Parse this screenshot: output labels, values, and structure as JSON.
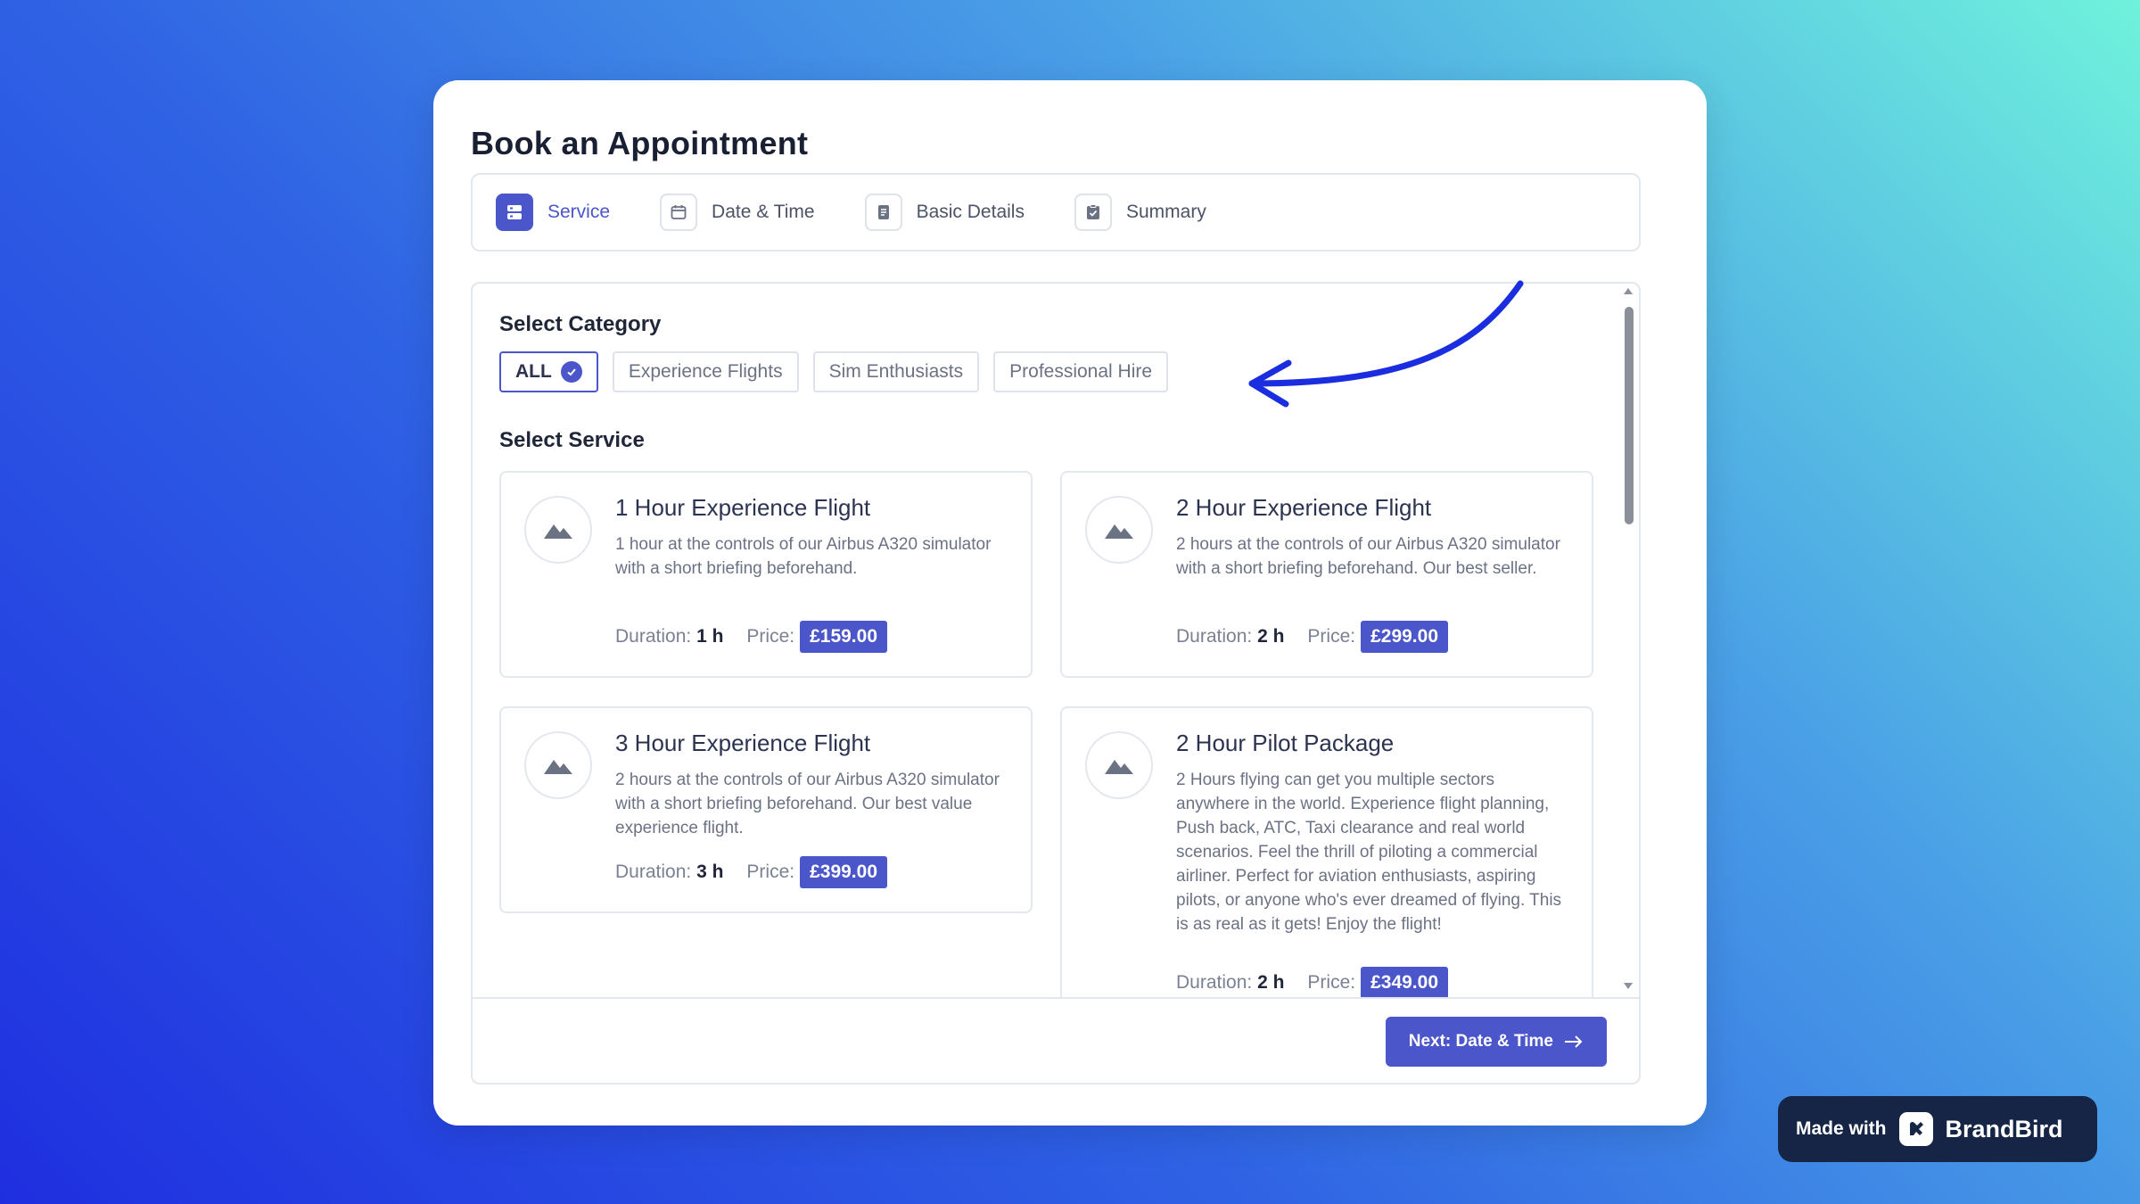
{
  "page": {
    "title": "Book an Appointment"
  },
  "steps": [
    {
      "label": "Service",
      "icon": "service-icon",
      "active": true
    },
    {
      "label": "Date & Time",
      "icon": "calendar-icon",
      "active": false
    },
    {
      "label": "Basic Details",
      "icon": "document-icon",
      "active": false
    },
    {
      "label": "Summary",
      "icon": "checklist-icon",
      "active": false
    }
  ],
  "category": {
    "title": "Select Category",
    "chips": [
      {
        "label": "ALL",
        "selected": true
      },
      {
        "label": "Experience Flights",
        "selected": false
      },
      {
        "label": "Sim Enthusiasts",
        "selected": false
      },
      {
        "label": "Professional Hire",
        "selected": false
      }
    ]
  },
  "service": {
    "title": "Select Service",
    "duration_label": "Duration:",
    "price_label": "Price:",
    "items": [
      {
        "name": "1 Hour Experience Flight",
        "description": "1 hour at the controls of our Airbus A320 simulator with a short briefing beforehand.",
        "duration": "1 h",
        "price": "£159.00"
      },
      {
        "name": "2 Hour Experience Flight",
        "description": "2 hours at the controls of our Airbus A320 simulator with a short briefing beforehand. Our best seller.",
        "duration": "2 h",
        "price": "£299.00"
      },
      {
        "name": "3 Hour Experience Flight",
        "description": "2 hours at the controls of our Airbus A320 simulator with a short briefing beforehand. Our best value experience flight.",
        "duration": "3 h",
        "price": "£399.00"
      },
      {
        "name": "2 Hour Pilot Package",
        "description": "2 Hours flying can get you multiple sectors anywhere in the world. Experience flight planning, Push back, ATC, Taxi clearance and real world scenarios. Feel the thrill of piloting a commercial airliner. Perfect for aviation enthusiasts, aspiring pilots, or anyone who's ever dreamed of flying. This is as real as it gets! Enjoy the flight!",
        "duration": "2 h",
        "price": "£349.00"
      }
    ]
  },
  "footer": {
    "next_label": "Next: Date & Time"
  },
  "badge": {
    "made_with": "Made with",
    "brand": "BrandBird"
  },
  "colors": {
    "accent": "#4a56c9",
    "arrow": "#1a2ee0",
    "badge_bg": "#162545"
  }
}
